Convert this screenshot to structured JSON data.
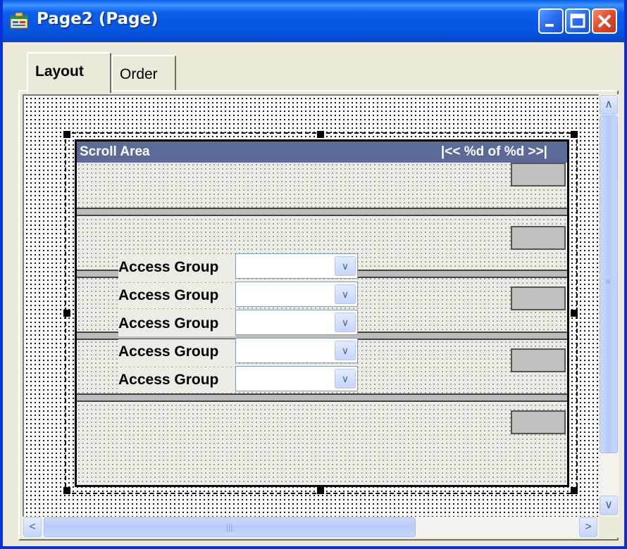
{
  "window": {
    "title": "Page2 (Page)",
    "controls": {
      "minimize": "minimize-icon",
      "maximize": "maximize-icon",
      "close": "close-icon"
    }
  },
  "tabs": [
    {
      "label": "Layout",
      "active": true
    },
    {
      "label": "Order",
      "active": false
    }
  ],
  "scroll_area": {
    "title": "Scroll Area",
    "nav": "|<< %d of %d >>|"
  },
  "access_groups": [
    {
      "label": "Access Group",
      "value": ""
    },
    {
      "label": "Access Group",
      "value": ""
    },
    {
      "label": "Access Group",
      "value": ""
    },
    {
      "label": "Access Group",
      "value": ""
    },
    {
      "label": "Access Group",
      "value": ""
    }
  ],
  "colors": {
    "titlebar": "#0A5FEB",
    "scroll_header": "#5C6A99",
    "close_button": "#E1492A"
  }
}
